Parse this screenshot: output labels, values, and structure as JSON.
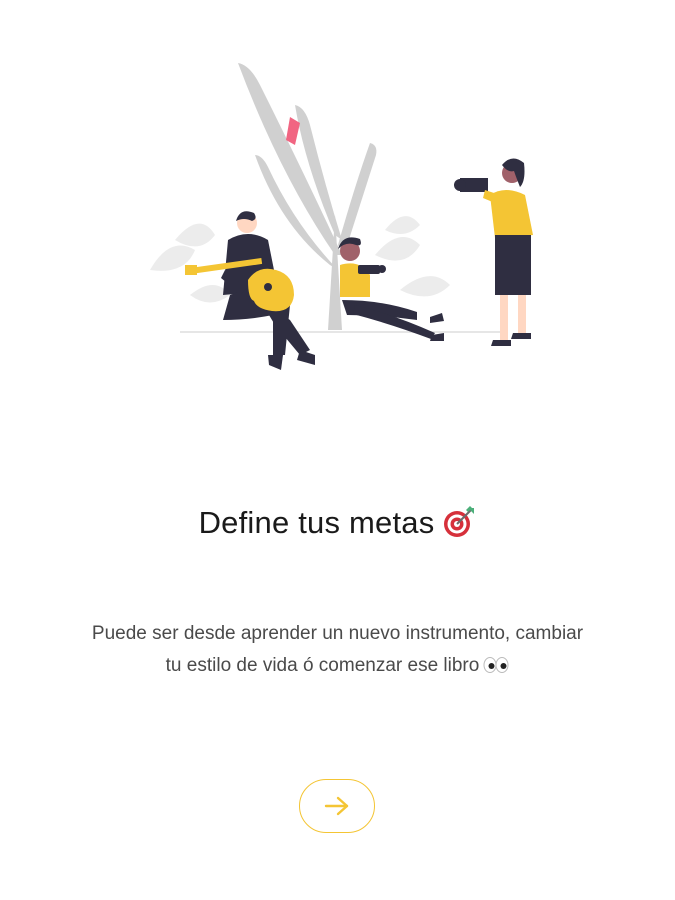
{
  "onboarding": {
    "title": "Define tus metas",
    "title_emoji": "target-dart-icon",
    "description_line1": "Puede ser desde aprender un nuevo instrumento, cambiar",
    "description_line2": "tu estilo de vida ó comenzar ese libro",
    "description_emoji": "eyes-icon",
    "next_button_icon": "arrow-right-icon"
  },
  "colors": {
    "accent": "#f4c534",
    "title_text": "#1a1a1a",
    "body_text": "#4a4a4a",
    "background": "#ffffff"
  }
}
